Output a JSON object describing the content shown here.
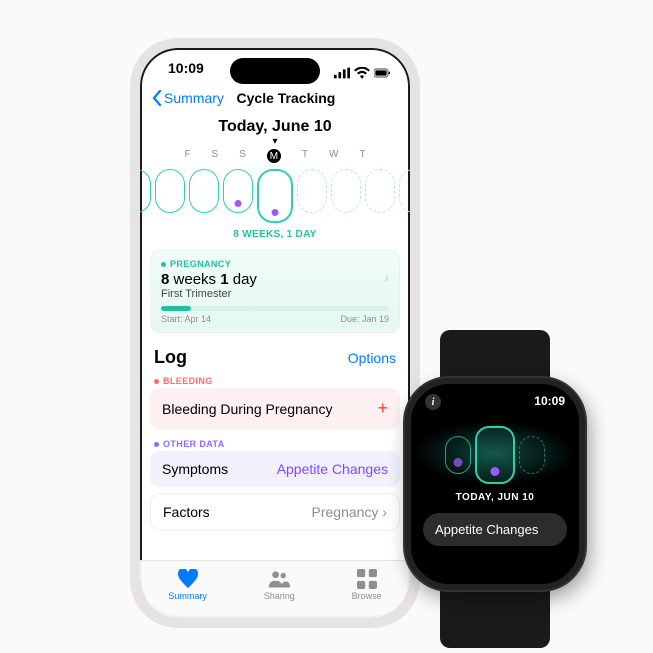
{
  "phone": {
    "status": {
      "time": "10:09"
    },
    "nav": {
      "back": "Summary",
      "title": "Cycle Tracking"
    },
    "today_header": "Today, June 10",
    "day_labels": [
      "F",
      "S",
      "S",
      "M",
      "T",
      "W",
      "T"
    ],
    "weeks_line": "8 WEEKS, 1 DAY",
    "pregnancy": {
      "tag": "PREGNANCY",
      "weeks_num": "8",
      "weeks_unit": "weeks",
      "days_num": "1",
      "days_unit": "day",
      "trimester": "First Trimester",
      "start": "Start: Apr 14",
      "due": "Due: Jan 19"
    },
    "log": {
      "heading": "Log",
      "options": "Options",
      "bleeding_tag": "BLEEDING",
      "bleeding_row": "Bleeding During Pregnancy",
      "other_tag": "OTHER DATA",
      "symptoms_label": "Symptoms",
      "symptoms_value": "Appetite Changes",
      "factors_label": "Factors",
      "factors_value": "Pregnancy"
    },
    "tabs": {
      "summary": "Summary",
      "sharing": "Sharing",
      "browse": "Browse"
    }
  },
  "watch": {
    "time": "10:09",
    "today": "TODAY, JUN 10",
    "chip": "Appetite Changes"
  }
}
